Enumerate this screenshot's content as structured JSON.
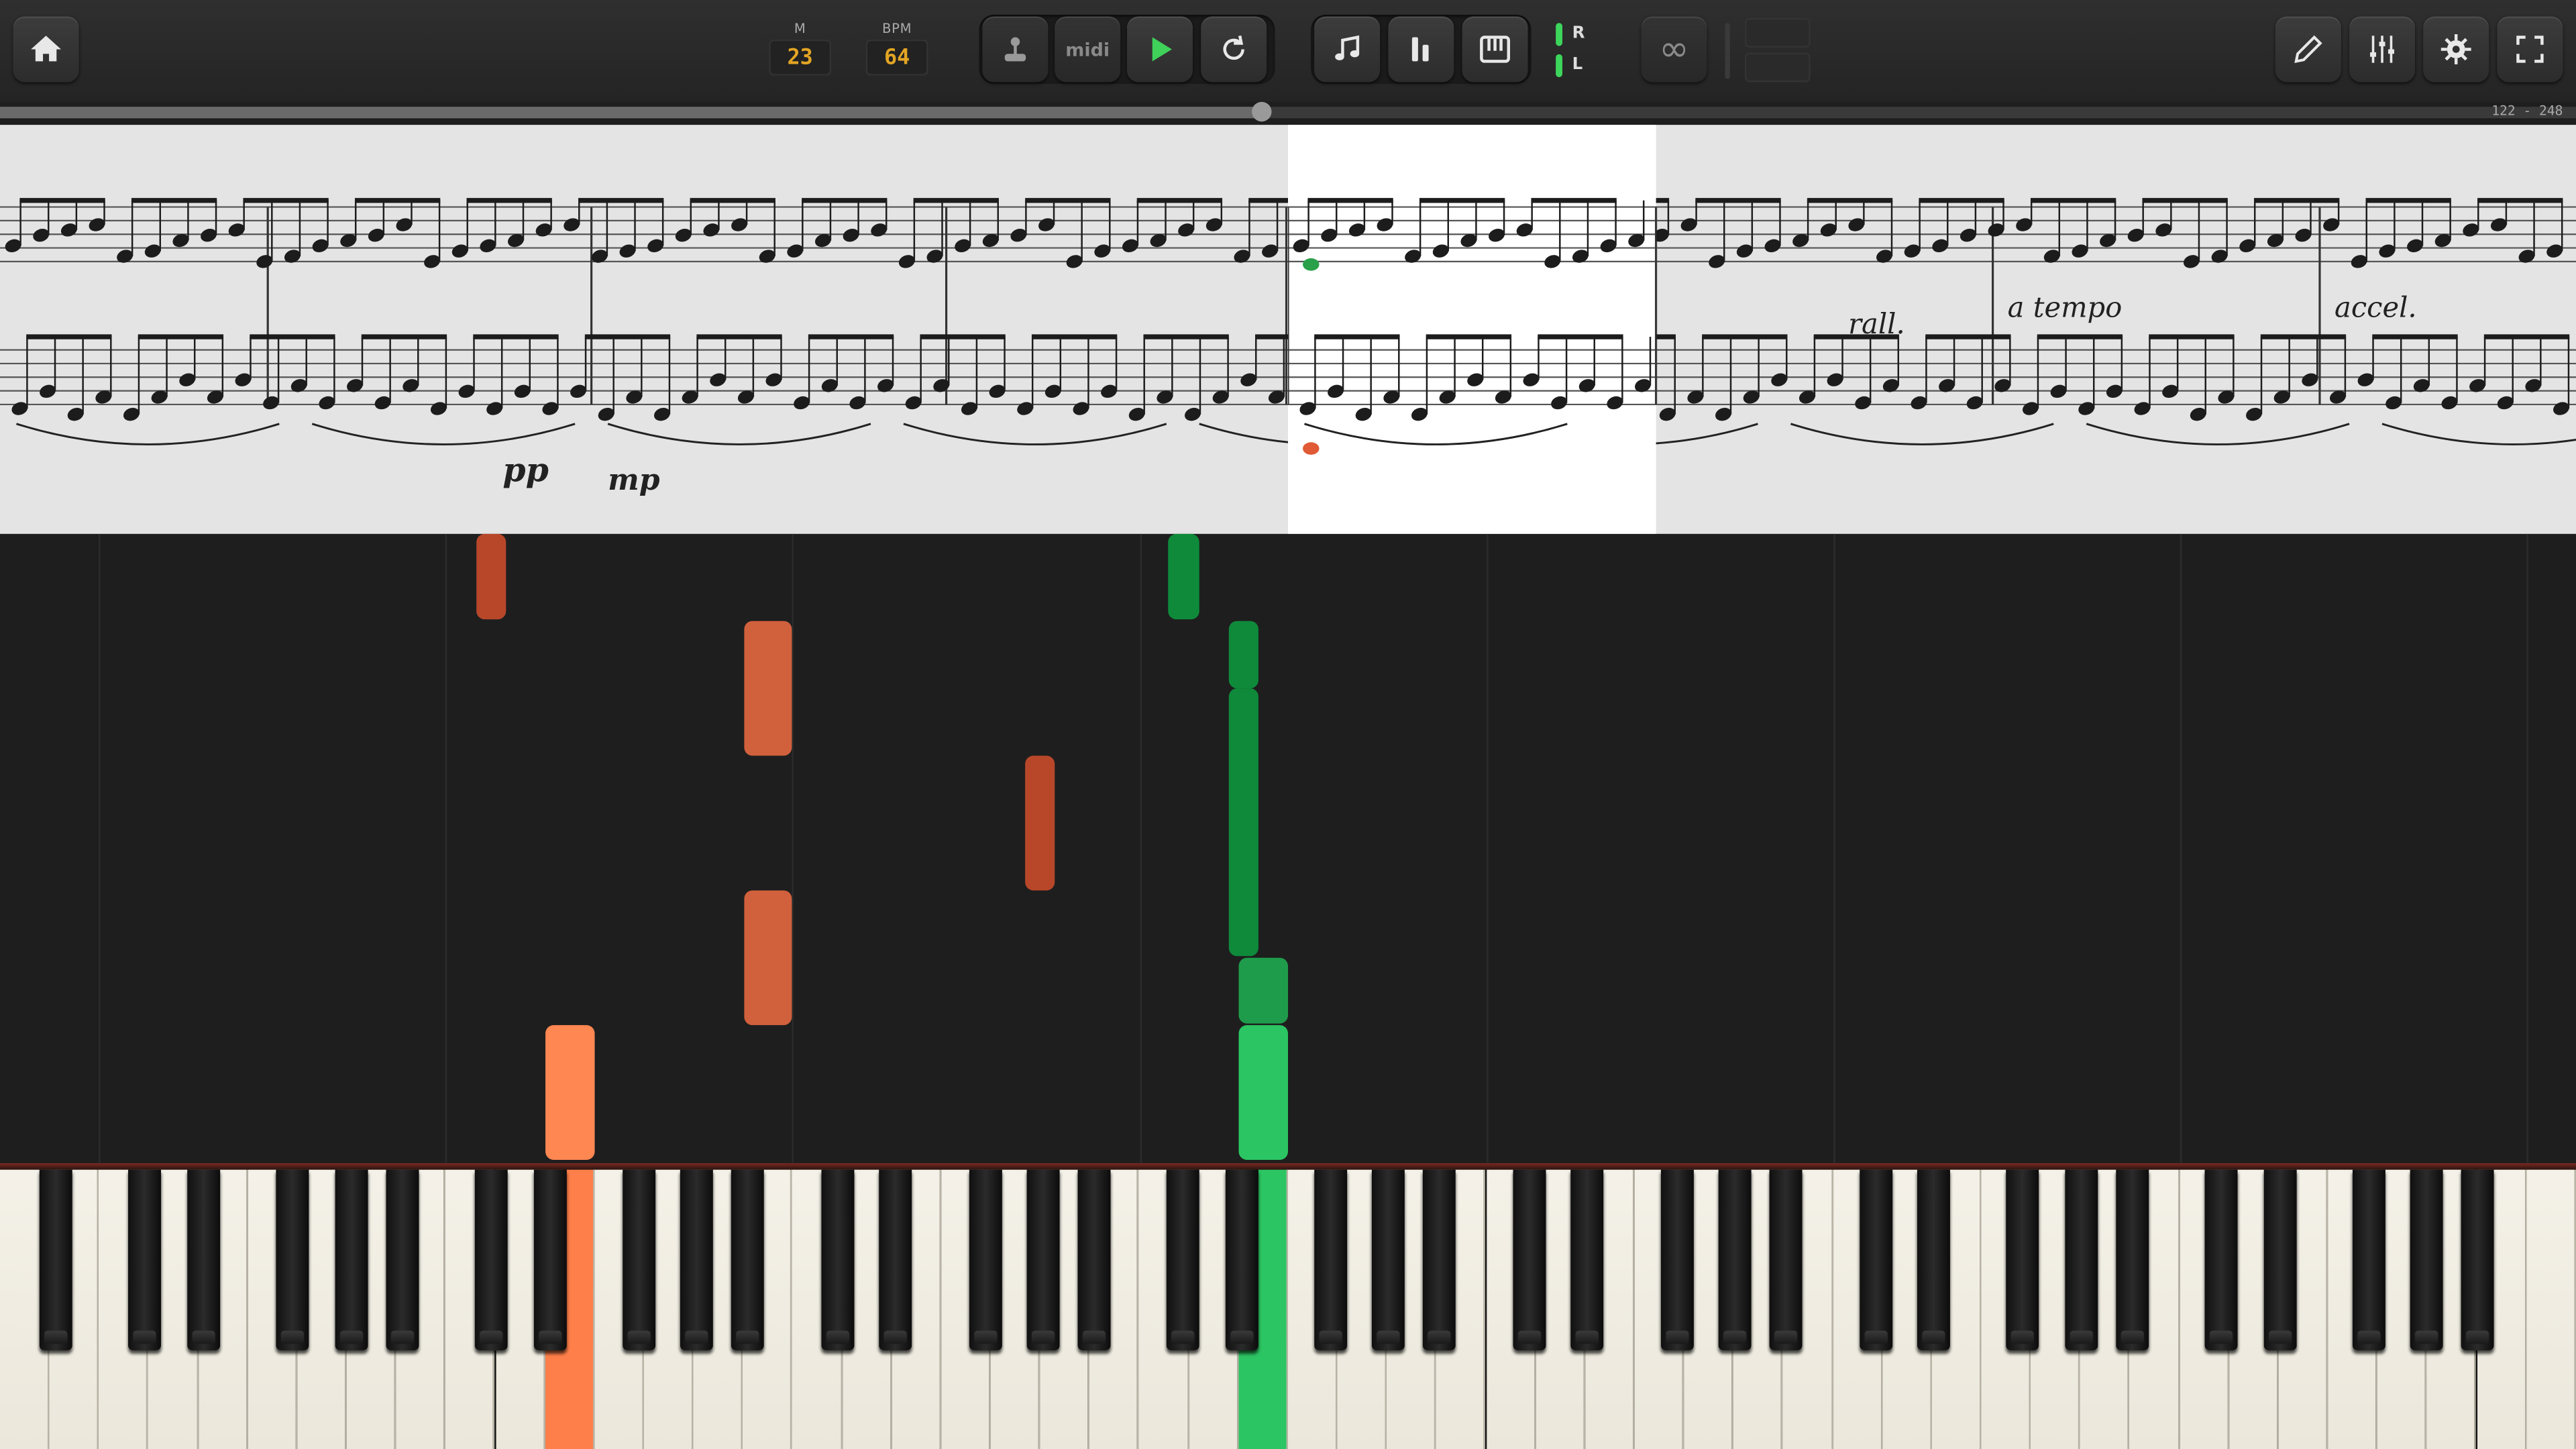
{
  "toolbar": {
    "measure_label": "M",
    "measure_value": "23",
    "bpm_label": "BPM",
    "bpm_value": "64",
    "midi_label": "midi",
    "hand_right": "R",
    "hand_left": "L",
    "loop_symbol": "∞",
    "icons": [
      "home-icon",
      "joystick-icon",
      "midi-icon",
      "play-icon",
      "restart-icon",
      "music-note-icon",
      "bars-icon",
      "piano-icon",
      "loop-icon",
      "pencil-icon",
      "mixer-icon",
      "gear-icon",
      "fullscreen-icon"
    ],
    "colors": {
      "play": "#3fd15a",
      "lcd": "#e3a524",
      "hand_indicator": "#3dd65c"
    }
  },
  "progress": {
    "fraction": 0.49,
    "range_label": "122 - 248"
  },
  "score": {
    "dynamics": {
      "pp": "pp",
      "mp": "mp",
      "rall": "rall.",
      "a_tempo": "a tempo",
      "accel": "accel."
    },
    "current_measure_highlight": true
  },
  "falling_notes": {
    "colors": {
      "left_hand": "#d1603c",
      "left_hand_dark": "#b8472a",
      "left_hand_active": "#ff8752",
      "right_hand": "#0e8a3a",
      "right_hand_active": "#2cc563"
    }
  },
  "keyboard": {
    "pressed": [
      {
        "hand": "left",
        "color": "#ff7f4a"
      },
      {
        "hand": "right",
        "color": "#2cc563"
      }
    ]
  }
}
